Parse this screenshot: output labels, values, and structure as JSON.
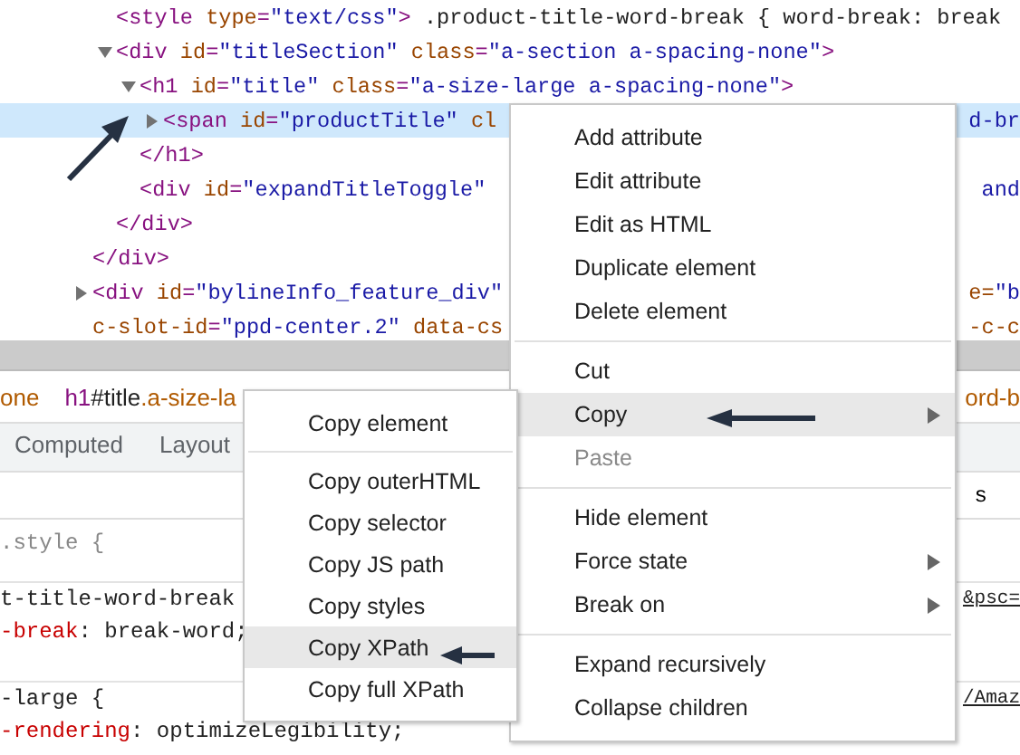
{
  "elements_tree": {
    "children": [
      {
        "selected": false,
        "tokens": [
          {
            "kind": "tag",
            "text": "<style "
          },
          {
            "kind": "attr",
            "text": "type"
          },
          {
            "kind": "tag",
            "text": "="
          },
          {
            "kind": "value",
            "text": "\"text/css\""
          },
          {
            "kind": "tag",
            "text": ">"
          },
          {
            "kind": "text",
            "text": " .product-title-word-break { word-break: break"
          }
        ]
      },
      {
        "expanded": true,
        "selected": false,
        "tokens": [
          {
            "kind": "tag",
            "text": "<div "
          },
          {
            "kind": "attr",
            "text": "id"
          },
          {
            "kind": "tag",
            "text": "="
          },
          {
            "kind": "value",
            "text": "\"titleSection\""
          },
          {
            "kind": "attr",
            "text": " class"
          },
          {
            "kind": "tag",
            "text": "="
          },
          {
            "kind": "value",
            "text": "\"a-section a-spacing-none\""
          },
          {
            "kind": "tag",
            "text": ">"
          }
        ],
        "children": [
          {
            "expanded": true,
            "selected": false,
            "tokens": [
              {
                "kind": "tag",
                "text": "<h1 "
              },
              {
                "kind": "attr",
                "text": "id"
              },
              {
                "kind": "tag",
                "text": "="
              },
              {
                "kind": "value",
                "text": "\"title\""
              },
              {
                "kind": "attr",
                "text": " class"
              },
              {
                "kind": "tag",
                "text": "="
              },
              {
                "kind": "value",
                "text": "\"a-size-large a-spacing-none\""
              },
              {
                "kind": "tag",
                "text": ">"
              }
            ],
            "children": [
              {
                "expanded": false,
                "selected": true,
                "tokens": [
                  {
                    "kind": "tag",
                    "text": "<span "
                  },
                  {
                    "kind": "attr",
                    "text": "id"
                  },
                  {
                    "kind": "tag",
                    "text": "="
                  },
                  {
                    "kind": "value",
                    "text": "\"productTitle\""
                  },
                  {
                    "kind": "attr",
                    "text": " cl"
                  }
                ],
                "right": [
                  {
                    "kind": "value",
                    "text": "d-br"
                  }
                ]
              }
            ],
            "closing": [
              {
                "kind": "tag",
                "text": "</h1>"
              }
            ]
          },
          {
            "selected": false,
            "tokens": [
              {
                "kind": "tag",
                "text": "<div "
              },
              {
                "kind": "attr",
                "text": "id"
              },
              {
                "kind": "tag",
                "text": "="
              },
              {
                "kind": "value",
                "text": "\"expandTitleToggle\""
              }
            ],
            "right": [
              {
                "kind": "value",
                "text": "and"
              }
            ]
          }
        ],
        "closing": [
          {
            "kind": "tag",
            "text": "</div>"
          }
        ]
      }
    ],
    "closing": [
      {
        "kind": "tag",
        "text": "</div>"
      }
    ],
    "siblings": [
      {
        "expanded": false,
        "selected": false,
        "tokens": [
          {
            "kind": "tag",
            "text": "<div "
          },
          {
            "kind": "attr",
            "text": "id"
          },
          {
            "kind": "tag",
            "text": "="
          },
          {
            "kind": "value",
            "text": "\"bylineInfo_feature_div\""
          }
        ],
        "right": [
          {
            "kind": "attr",
            "text": "e="
          },
          {
            "kind": "value",
            "text": "\"b"
          }
        ],
        "continuation": {
          "tokens": [
            {
              "kind": "attr",
              "text": "c-slot-id"
            },
            {
              "kind": "tag",
              "text": "="
            },
            {
              "kind": "value",
              "text": "\"ppd-center.2\""
            },
            {
              "kind": "attr",
              "text": " data-cs"
            }
          ],
          "right": [
            {
              "kind": "attr",
              "text": "-c-c"
            }
          ]
        }
      }
    ]
  },
  "breadcrumbs": {
    "items": [
      {
        "tokens": [
          {
            "kind": "cls",
            "text": "one"
          }
        ]
      },
      {
        "tokens": [
          {
            "kind": "tag",
            "text": "h1"
          },
          {
            "kind": "text",
            "text": "#title"
          },
          {
            "kind": "cls",
            "text": ".a-size-la"
          }
        ]
      }
    ],
    "right": [
      {
        "kind": "cls",
        "text": "ord-b"
      }
    ]
  },
  "tabs": [
    {
      "label": "Computed",
      "selected": false
    },
    {
      "label": "Layout",
      "selected": false
    }
  ],
  "filter_bar": {
    "right": "s"
  },
  "styles": [
    {
      "tokens": [
        {
          "kind": "muted",
          "text": ".style {"
        }
      ]
    },
    {
      "tokens": [
        {
          "kind": "text",
          "text": "t-title-word-break"
        }
      ],
      "link": "&psc="
    },
    {
      "tokens": [
        {
          "kind": "prop",
          "text": "-break"
        },
        {
          "kind": "text",
          "text": ": break-word;"
        }
      ]
    },
    {
      "tokens": [
        {
          "kind": "text",
          "text": "-large {"
        }
      ],
      "link": "/Amaz"
    },
    {
      "tokens": [
        {
          "kind": "prop",
          "text": "-rendering"
        },
        {
          "kind": "text",
          "text": ": optimizeLegibility;"
        }
      ]
    }
  ],
  "context_menu": {
    "groups": [
      [
        {
          "label": "Add attribute",
          "selected": false,
          "disabled": false,
          "submenu": false
        },
        {
          "label": "Edit attribute",
          "selected": false,
          "disabled": false,
          "submenu": false
        },
        {
          "label": "Edit as HTML",
          "selected": false,
          "disabled": false,
          "submenu": false
        },
        {
          "label": "Duplicate element",
          "selected": false,
          "disabled": false,
          "submenu": false
        },
        {
          "label": "Delete element",
          "selected": false,
          "disabled": false,
          "submenu": false
        }
      ],
      [
        {
          "label": "Cut",
          "selected": false,
          "disabled": false,
          "submenu": false
        },
        {
          "label": "Copy",
          "selected": true,
          "disabled": false,
          "submenu": true
        },
        {
          "label": "Paste",
          "selected": false,
          "disabled": true,
          "submenu": false
        }
      ],
      [
        {
          "label": "Hide element",
          "selected": false,
          "disabled": false,
          "submenu": false
        },
        {
          "label": "Force state",
          "selected": false,
          "disabled": false,
          "submenu": true
        },
        {
          "label": "Break on",
          "selected": false,
          "disabled": false,
          "submenu": true
        }
      ],
      [
        {
          "label": "Expand recursively",
          "selected": false,
          "disabled": false,
          "submenu": false
        },
        {
          "label": "Collapse children",
          "selected": false,
          "disabled": false,
          "submenu": false
        }
      ]
    ]
  },
  "copy_submenu": {
    "groups": [
      [
        {
          "label": "Copy element",
          "selected": false,
          "disabled": false,
          "submenu": false
        }
      ],
      [
        {
          "label": "Copy outerHTML",
          "selected": false,
          "disabled": false,
          "submenu": false
        },
        {
          "label": "Copy selector",
          "selected": false,
          "disabled": false,
          "submenu": false
        },
        {
          "label": "Copy JS path",
          "selected": false,
          "disabled": false,
          "submenu": false
        },
        {
          "label": "Copy styles",
          "selected": false,
          "disabled": false,
          "submenu": false
        },
        {
          "label": "Copy XPath",
          "selected": true,
          "disabled": false,
          "submenu": false
        },
        {
          "label": "Copy full XPath",
          "selected": false,
          "disabled": false,
          "submenu": false
        }
      ]
    ]
  }
}
